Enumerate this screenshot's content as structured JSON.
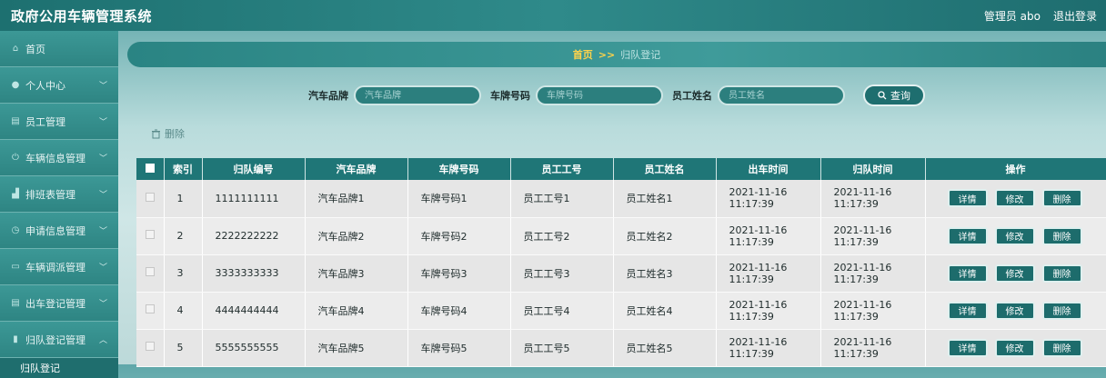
{
  "app": {
    "title": "政府公用车辆管理系统"
  },
  "header": {
    "admin_label": "管理员 abo",
    "logout_label": "退出登录"
  },
  "sidebar": {
    "items": [
      {
        "label": "首页",
        "icon": "home-icon",
        "glyph": "⌂",
        "has_chevron": false
      },
      {
        "label": "个人中心",
        "icon": "user-icon",
        "glyph": "●",
        "has_chevron": true
      },
      {
        "label": "员工管理",
        "icon": "list-icon",
        "glyph": "▤",
        "has_chevron": true
      },
      {
        "label": "车辆信息管理",
        "icon": "power-icon",
        "glyph": "⏻",
        "has_chevron": true
      },
      {
        "label": "排班表管理",
        "icon": "chart-icon",
        "glyph": "▟",
        "has_chevron": true
      },
      {
        "label": "申请信息管理",
        "icon": "clock-icon",
        "glyph": "◷",
        "has_chevron": true
      },
      {
        "label": "车辆调派管理",
        "icon": "panel-icon",
        "glyph": "▭",
        "has_chevron": true
      },
      {
        "label": "出车登记管理",
        "icon": "stack-icon",
        "glyph": "▤",
        "has_chevron": true
      },
      {
        "label": "归队登记管理",
        "icon": "bars-icon",
        "glyph": "▮",
        "has_chevron": true,
        "expanded": true
      }
    ],
    "sub_items": [
      {
        "label": "归队登记"
      }
    ]
  },
  "breadcrumb": {
    "home": "首页",
    "separator": ">>",
    "current": "归队登记"
  },
  "search": {
    "brand_label": "汽车品牌",
    "brand_placeholder": "汽车品牌",
    "plate_label": "车牌号码",
    "plate_placeholder": "车牌号码",
    "name_label": "员工姓名",
    "name_placeholder": "员工姓名",
    "query_label": "查询"
  },
  "toolbar": {
    "delete_label": "删除"
  },
  "table": {
    "columns": [
      "索引",
      "归队编号",
      "汽车品牌",
      "车牌号码",
      "员工工号",
      "员工姓名",
      "出车时间",
      "归队时间",
      "操作"
    ],
    "actions": {
      "detail": "详情",
      "edit": "修改",
      "delete": "删除"
    },
    "rows": [
      {
        "index": "1",
        "number": "1111111111",
        "brand": "汽车品牌1",
        "plate": "车牌号码1",
        "emp_id": "员工工号1",
        "emp_name": "员工姓名1",
        "out_time": "2021-11-16 11:17:39",
        "return_time": "2021-11-16 11:17:39"
      },
      {
        "index": "2",
        "number": "2222222222",
        "brand": "汽车品牌2",
        "plate": "车牌号码2",
        "emp_id": "员工工号2",
        "emp_name": "员工姓名2",
        "out_time": "2021-11-16 11:17:39",
        "return_time": "2021-11-16 11:17:39"
      },
      {
        "index": "3",
        "number": "3333333333",
        "brand": "汽车品牌3",
        "plate": "车牌号码3",
        "emp_id": "员工工号3",
        "emp_name": "员工姓名3",
        "out_time": "2021-11-16 11:17:39",
        "return_time": "2021-11-16 11:17:39"
      },
      {
        "index": "4",
        "number": "4444444444",
        "brand": "汽车品牌4",
        "plate": "车牌号码4",
        "emp_id": "员工工号4",
        "emp_name": "员工姓名4",
        "out_time": "2021-11-16 11:17:39",
        "return_time": "2021-11-16 11:17:39"
      },
      {
        "index": "5",
        "number": "5555555555",
        "brand": "汽车品牌5",
        "plate": "车牌号码5",
        "emp_id": "员工工号5",
        "emp_name": "员工姓名5",
        "out_time": "2021-11-16 11:17:39",
        "return_time": "2021-11-16 11:17:39"
      }
    ]
  }
}
